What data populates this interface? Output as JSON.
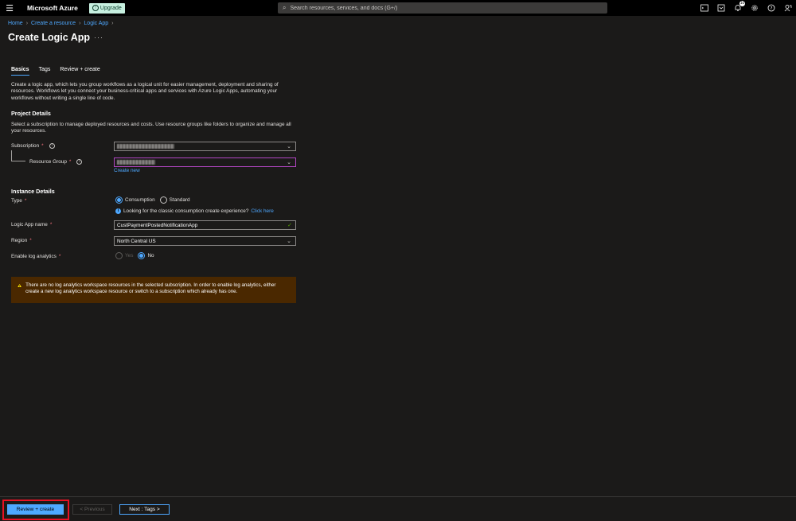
{
  "topbar": {
    "brand": "Microsoft Azure",
    "upgrade_label": "Upgrade",
    "search_placeholder": "Search resources, services, and docs (G+/)",
    "notification_count": "10"
  },
  "breadcrumb": [
    "Home",
    "Create a resource",
    "Logic App"
  ],
  "page": {
    "title": "Create Logic App",
    "more": "···"
  },
  "tabs": [
    {
      "label": "Basics",
      "active": true
    },
    {
      "label": "Tags",
      "active": false
    },
    {
      "label": "Review + create",
      "active": false
    }
  ],
  "description": "Create a logic app, which lets you group workflows as a logical unit for easier management, deployment and sharing of resources. Workflows let you connect your business-critical apps and services with Azure Logic Apps, automating your workflows without writing a single line of code.",
  "project": {
    "heading": "Project Details",
    "description": "Select a subscription to manage deployed resources and costs. Use resource groups like folders to organize and manage all your resources.",
    "subscription_label": "Subscription",
    "resource_group_label": "Resource Group",
    "create_new": "Create new"
  },
  "instance": {
    "heading": "Instance Details",
    "type_label": "Type",
    "type_options": [
      "Consumption",
      "Standard"
    ],
    "classic_info": "Looking for the classic consumption create experience?",
    "click_here": "Click here",
    "name_label": "Logic App name",
    "name_value": "CustPaymentPostedNotificationApp",
    "region_label": "Region",
    "region_value": "North Central US",
    "log_label": "Enable log analytics",
    "log_options": [
      "Yes",
      "No"
    ]
  },
  "warning": {
    "text": "There are no log analytics workspace resources in the selected subscription. In order to enable log analytics, either create a new log analytics workspace resource or switch to a subscription which already has one."
  },
  "footer": {
    "review_create": "Review + create",
    "previous": "< Previous",
    "next": "Next : Tags >"
  },
  "colors": {
    "accent": "#4ea8ff",
    "warning_bg": "#4a2800",
    "highlight": "#e81123"
  }
}
